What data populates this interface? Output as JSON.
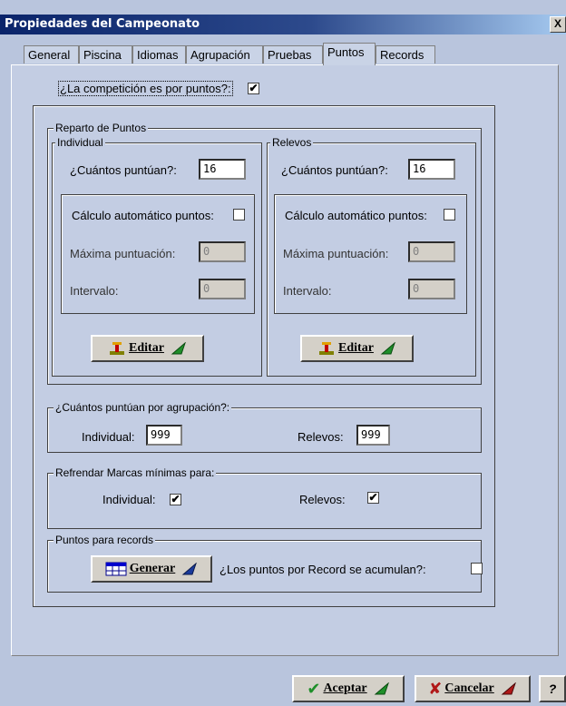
{
  "window": {
    "title": "Propiedades del Campeonato",
    "close_label": "X"
  },
  "tabs": [
    {
      "label": "General"
    },
    {
      "label": "Piscina"
    },
    {
      "label": "Idiomas"
    },
    {
      "label": "Agrupación"
    },
    {
      "label": "Pruebas"
    },
    {
      "label": "Puntos",
      "active": true
    },
    {
      "label": "Records"
    }
  ],
  "points_toggle": {
    "label": "¿La competición es por puntos?:",
    "checked": true,
    "mark": "✔"
  },
  "reparto": {
    "title": "Reparto de Puntos",
    "individual": {
      "title": "Individual",
      "cuantos_label": "¿Cuántos puntúan?:",
      "cuantos_value": "16",
      "calc_label": "Cálculo automático puntos:",
      "calc_checked": false,
      "max_label": "Máxima puntuación:",
      "max_value": "0",
      "interval_label": "Intervalo:",
      "interval_value": "0",
      "edit_label": "Editar"
    },
    "relevos": {
      "title": "Relevos",
      "cuantos_label": "¿Cuántos puntúan?:",
      "cuantos_value": "16",
      "calc_label": "Cálculo automático puntos:",
      "calc_checked": false,
      "max_label": "Máxima puntuación:",
      "max_value": "0",
      "interval_label": "Intervalo:",
      "interval_value": "0",
      "edit_label": "Editar"
    }
  },
  "agrupacion": {
    "title": "¿Cuántos puntúan por agrupación?:",
    "individual_label": "Individual:",
    "individual_value": "999",
    "relevos_label": "Relevos:",
    "relevos_value": "999"
  },
  "refrendar": {
    "title": "Refrendar Marcas mínimas para:",
    "individual_label": "Individual:",
    "individual_checked": true,
    "relevos_label": "Relevos:",
    "relevos_checked": true,
    "mark": "✔"
  },
  "records": {
    "title": "Puntos para records",
    "generate_label": "Generar",
    "acumulan_label": "¿Los puntos por Record se acumulan?:",
    "acumulan_checked": false
  },
  "footer": {
    "accept_label": "Aceptar",
    "cancel_label": "Cancelar",
    "help_label": "?"
  },
  "colors": {
    "title_start": "#0a246a",
    "accept_green": "#1f8f2a",
    "cancel_red": "#b01818"
  }
}
